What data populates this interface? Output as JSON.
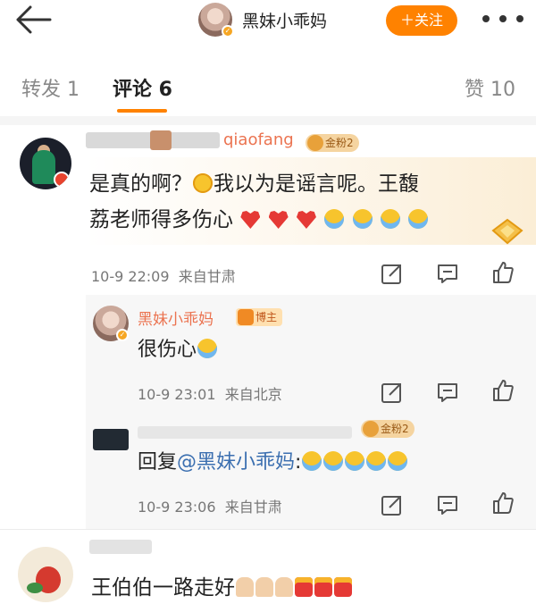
{
  "header": {
    "title": "黑妹小乖妈",
    "follow_label": "＋关注"
  },
  "tabs": {
    "repost_label": "转发 1",
    "comments_label": "评论 6",
    "likes_label": "赞 10"
  },
  "comments": [
    {
      "username_visible": "qiaofang",
      "fan_badge": "金粉2",
      "text_parts": [
        "是真的啊？",
        "我以为是谣言呢。王馥",
        "荔老师得多伤心"
      ],
      "emojis": [
        "shock-emoji",
        "broken-heart-emoji",
        "broken-heart-emoji",
        "broken-heart-emoji",
        "crying-emoji",
        "crying-emoji",
        "crying-emoji",
        "crying-emoji"
      ],
      "time": "10-9 22:09",
      "location": "来自甘肃",
      "replies": [
        {
          "username": "黑妹小乖妈",
          "badge": "博主",
          "text": "很伤心",
          "time": "10-9 23:01",
          "location": "来自北京"
        },
        {
          "fan_badge": "金粉2",
          "reply_prefix": "回复",
          "mention": "@黑妹小乖妈",
          "suffix": ":",
          "time": "10-9 23:06",
          "location": "来自甘肃"
        }
      ]
    },
    {
      "text": "王伯伯一路走好",
      "emojis": [
        "pray-emoji",
        "pray-emoji",
        "pray-emoji",
        "candle-emoji",
        "candle-emoji",
        "candle-emoji"
      ]
    }
  ],
  "colors": {
    "accent": "#ff8200",
    "reply_username": "#eb7350",
    "mention": "#3b6fb0"
  },
  "icons": [
    "back-arrow-icon",
    "more-dots-icon",
    "share-icon",
    "comment-icon",
    "like-icon",
    "gem-icon"
  ]
}
